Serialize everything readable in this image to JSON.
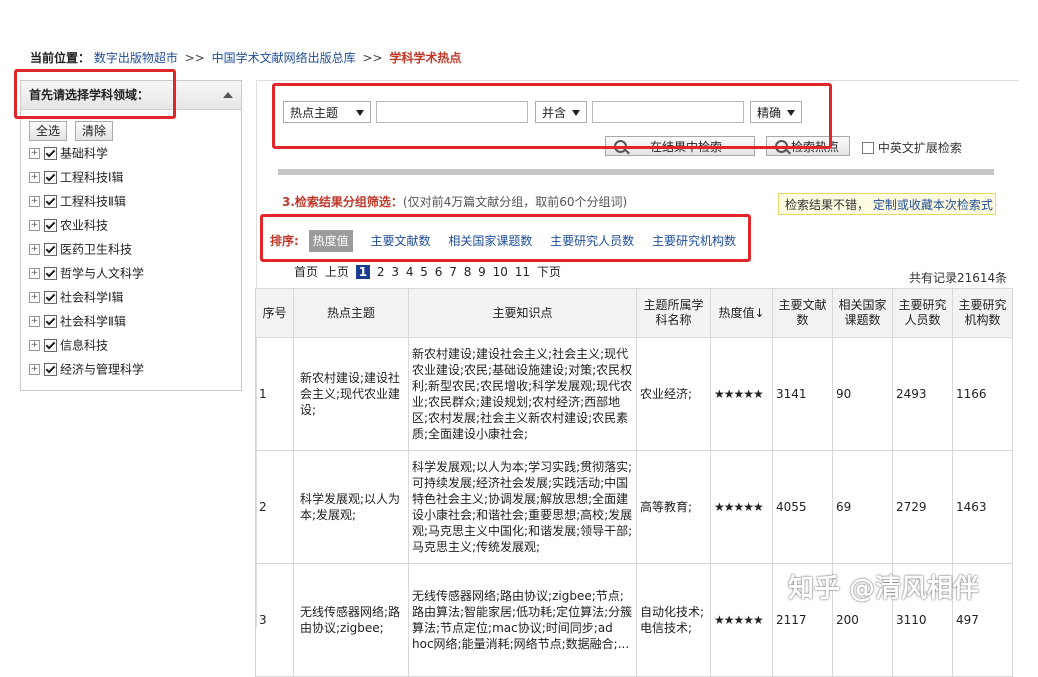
{
  "breadcrumb": {
    "label": "当前位置：",
    "link1": "数字出版物超市",
    "sep": ">>",
    "link2": "中国学术文献网络出版总库",
    "current": "学科学术热点"
  },
  "left_panel": {
    "title": "首先请选择学科领域：",
    "select_all": "全选",
    "clear": "清除",
    "subjects": [
      "基础科学",
      "工程科技Ⅰ辑",
      "工程科技Ⅱ辑",
      "农业科技",
      "医药卫生科技",
      "哲学与人文科学",
      "社会科学Ⅰ辑",
      "社会科学Ⅱ辑",
      "信息科技",
      "经济与管理科学"
    ]
  },
  "search": {
    "field1": "热点主题",
    "logic": "并含",
    "mode": "精确",
    "search_in_results": "在结果中检索",
    "search_hot": "检索热点",
    "expand_label": "中英文扩展检索"
  },
  "grouping": {
    "title": "3.检索结果分组筛选：",
    "note": "(仅对前4万篇文献分组，取前60个分组词)",
    "custom_text": "检索结果不错，",
    "custom_link": "定制或收藏本次检索式"
  },
  "sort": {
    "label": "排序:",
    "items": [
      "热度值",
      "主要文献数",
      "相关国家课题数",
      "主要研究人员数",
      "主要研究机构数"
    ]
  },
  "pager": {
    "first": "首页",
    "prev": "上页",
    "current": "1",
    "pages": [
      "2",
      "3",
      "4",
      "5",
      "6",
      "7",
      "8",
      "9",
      "10",
      "11"
    ],
    "next": "下页",
    "total": "共有记录21614条"
  },
  "table": {
    "headers": [
      "序号",
      "热点主题",
      "主要知识点",
      "主题所属学科名称",
      "热度值↓",
      "主要文献数",
      "相关国家课题数",
      "主要研究人员数",
      "主要研究机构数"
    ],
    "rows": [
      {
        "no": "1",
        "topic": "新农村建设;建设社会主义;现代农业建设;",
        "points": "新农村建设;建设社会主义;社会主义;现代农业建设;农民;基础设施建设;对策;农民权利;新型农民;农民增收;科学发展观;现代农业;农民群众;建设规划;农村经济;西部地区;农村发展;社会主义新农村建设;农民素质;全面建设小康社会;",
        "subject": "农业经济;",
        "heat": "★★★★★",
        "docs": "3141",
        "projects": "90",
        "researchers": "2493",
        "institutions": "1166"
      },
      {
        "no": "2",
        "topic": "科学发展观;以人为本;发展观;",
        "points": "科学发展观;以人为本;学习实践;贯彻落实;可持续发展;经济社会发展;实践活动;中国特色社会主义;协调发展;解放思想;全面建设小康社会;和谐社会;重要思想;高校;发展观;马克思主义中国化;和谐发展;领导干部;马克思主义;传统发展观;",
        "subject": "高等教育;",
        "heat": "★★★★★",
        "docs": "4055",
        "projects": "69",
        "researchers": "2729",
        "institutions": "1463"
      },
      {
        "no": "3",
        "topic": "无线传感器网络;路由协议;zigbee;",
        "points": "无线传感器网络;路由协议;zigbee;节点;路由算法;智能家居;低功耗;定位算法;分簇算法;节点定位;mac协议;时间同步;ad hoc网络;能量消耗;网络节点;数据融合;...",
        "subject": "自动化技术;电信技术;",
        "heat": "★★★★★",
        "docs": "2117",
        "projects": "200",
        "researchers": "3110",
        "institutions": "497"
      }
    ]
  },
  "watermark": "知乎 @清风相伴"
}
